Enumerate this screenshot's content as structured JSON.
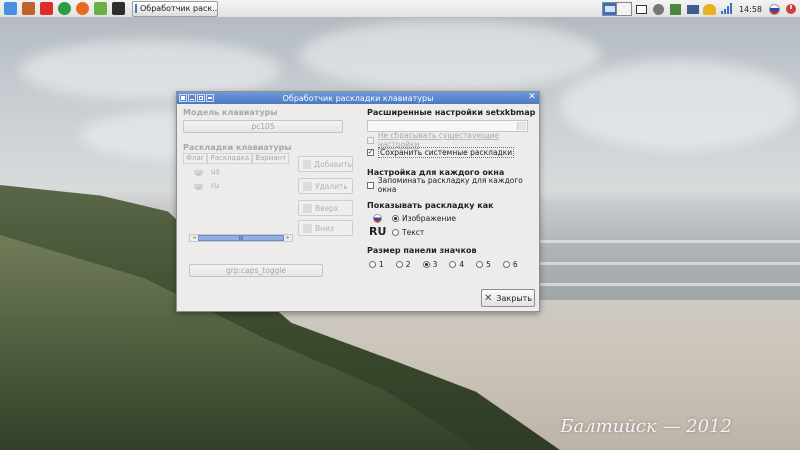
{
  "taskbar": {
    "launchers": [
      {
        "icon": "home-folder-icon",
        "color": "#4a90e2"
      },
      {
        "icon": "archive-icon",
        "color": "#c0622b"
      },
      {
        "icon": "yandex-browser-icon",
        "color": "#e02b2b"
      },
      {
        "icon": "chrome-icon",
        "color": "#2f9b46"
      },
      {
        "icon": "firefox-icon",
        "color": "#e66a1f"
      },
      {
        "icon": "feather-editor-icon",
        "color": "#6bb042"
      },
      {
        "icon": "terminal-icon",
        "color": "#2e2e2e"
      }
    ],
    "task_button_label": "Обработчик раск...",
    "clock": "14:58"
  },
  "dialog": {
    "title": "Обработчик раскладки клавиатуры",
    "left": {
      "model_label": "Модель клавиатуры",
      "model_value": "pc105",
      "layouts_label": "Раскладки клавиатуры",
      "columns": [
        "Флаг",
        "Раскладка",
        "Вариант"
      ],
      "layouts": [
        {
          "layout": "us"
        },
        {
          "layout": "ru"
        }
      ],
      "scroll_label": "III",
      "buttons": {
        "add": "Добавить",
        "remove": "Удалить",
        "up": "Вверх",
        "down": "Вниз"
      },
      "toggle_value": "grp:caps_toggle"
    },
    "right": {
      "setxkbmap_title": "Расширенные настройки setxkbmap",
      "no_reset_label": "Не сбрасывать существующие настройки",
      "keep_system_label": "Сохранить системные раскладки",
      "per_window_title": "Настройка для каждого окна",
      "remember_label": "Запоминать раскладку для каждого окна",
      "show_as_title": "Показывать раскладку как",
      "image_label": "Изображение",
      "text_label": "Текст",
      "ru_sample": "RU",
      "panel_size_title": "Размер панели значков",
      "sizes": [
        "1",
        "2",
        "3",
        "4",
        "5",
        "6"
      ],
      "selected_size": "3"
    },
    "close_label": "Закрыть"
  },
  "watermark": "Балтийск — 2012",
  "colors": {
    "titlebar": "#4a79c4",
    "accent": "#3a6fbf"
  }
}
